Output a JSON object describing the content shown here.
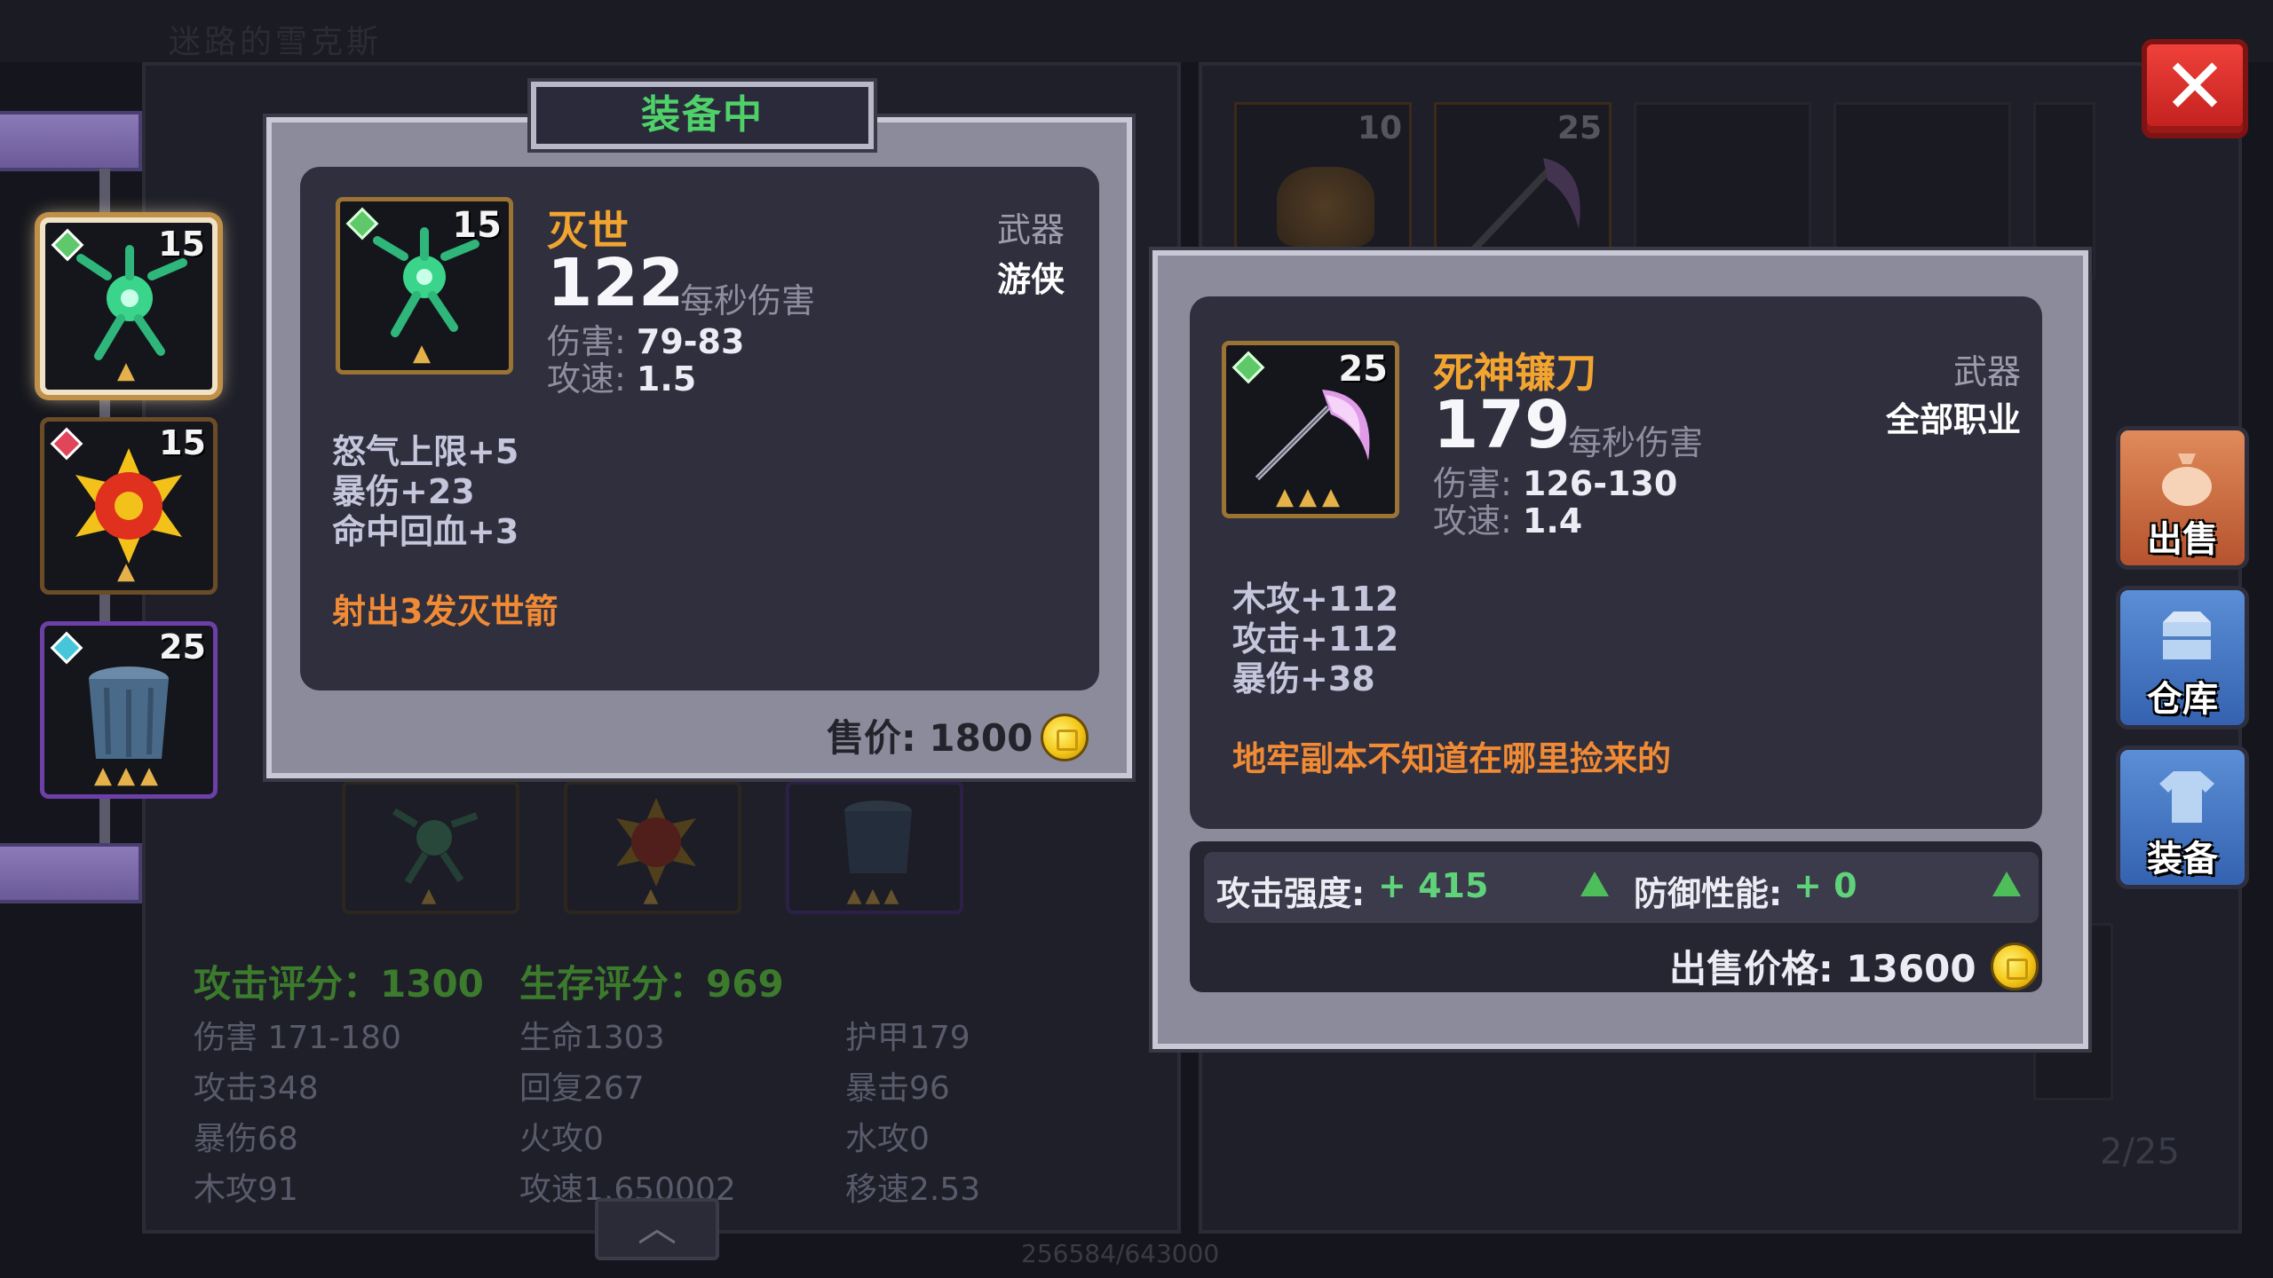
{
  "background": {
    "title": "迷路的雪克斯",
    "footer_progress": "256584/643000",
    "inventory_page": "2/25",
    "inventory_slots": [
      {
        "level": "10"
      },
      {
        "level": "25"
      }
    ]
  },
  "equipped_slots": [
    {
      "level": "15",
      "gem_color": "#5ec86a",
      "stars": "▲"
    },
    {
      "level": "15",
      "gem_color": "#e0455a",
      "stars": "▲"
    },
    {
      "level": "25",
      "gem_color": "#46c6d8",
      "stars": "▲▲▲"
    }
  ],
  "bottom_slots": [
    {
      "stars": "▲"
    },
    {
      "stars": "▲"
    },
    {
      "stars": "▲▲▲"
    }
  ],
  "stats": {
    "attack_score_label": "攻击评分：",
    "attack_score": "1300",
    "survival_score_label": "生存评分：",
    "survival_score": "969",
    "rows": [
      [
        "伤害 171-180",
        "生命1303",
        "护甲179"
      ],
      [
        "攻击348",
        "回复267",
        "暴击96"
      ],
      [
        "暴伤68",
        "火攻0",
        "水攻0"
      ],
      [
        "木攻91",
        "攻速1.650002",
        "移速2.53"
      ]
    ]
  },
  "equipped_panel": {
    "header": "装备中",
    "name": "灭世",
    "level": "15",
    "stars": "▲",
    "dps": "122",
    "dps_label": "每秒伤害",
    "damage_label": "伤害: ",
    "damage": "79-83",
    "speed_label": "攻速: ",
    "speed": "1.5",
    "category": "武器",
    "class": "游侠",
    "affixes": [
      "怒气上限+5",
      "暴伤+23",
      "命中回血+3"
    ],
    "special": "射出3发灭世箭",
    "price_label": "售价: ",
    "price": "1800"
  },
  "compare_panel": {
    "name": "死神镰刀",
    "level": "25",
    "stars": "▲▲▲",
    "dps": "179",
    "dps_label": "每秒伤害",
    "damage_label": "伤害: ",
    "damage": "126-130",
    "speed_label": "攻速: ",
    "speed": "1.4",
    "category": "武器",
    "class": "全部职业",
    "affixes": [
      "木攻+112",
      "攻击+112",
      "暴伤+38"
    ],
    "special": "地牢副本不知道在哪里捡来的",
    "attack_power_label": "攻击强度: ",
    "attack_power": "+ 415",
    "defense_label": "防御性能: ",
    "defense": "+ 0",
    "price_label": "出售价格: ",
    "price": "13600"
  },
  "side_buttons": {
    "sell": "出售",
    "warehouse": "仓库",
    "equip": "装备"
  },
  "colors": {
    "accent_green": "#4fd16a",
    "item_name_orange": "#f2a431",
    "special_orange": "#f08a35",
    "close_red": "#e0322d"
  }
}
